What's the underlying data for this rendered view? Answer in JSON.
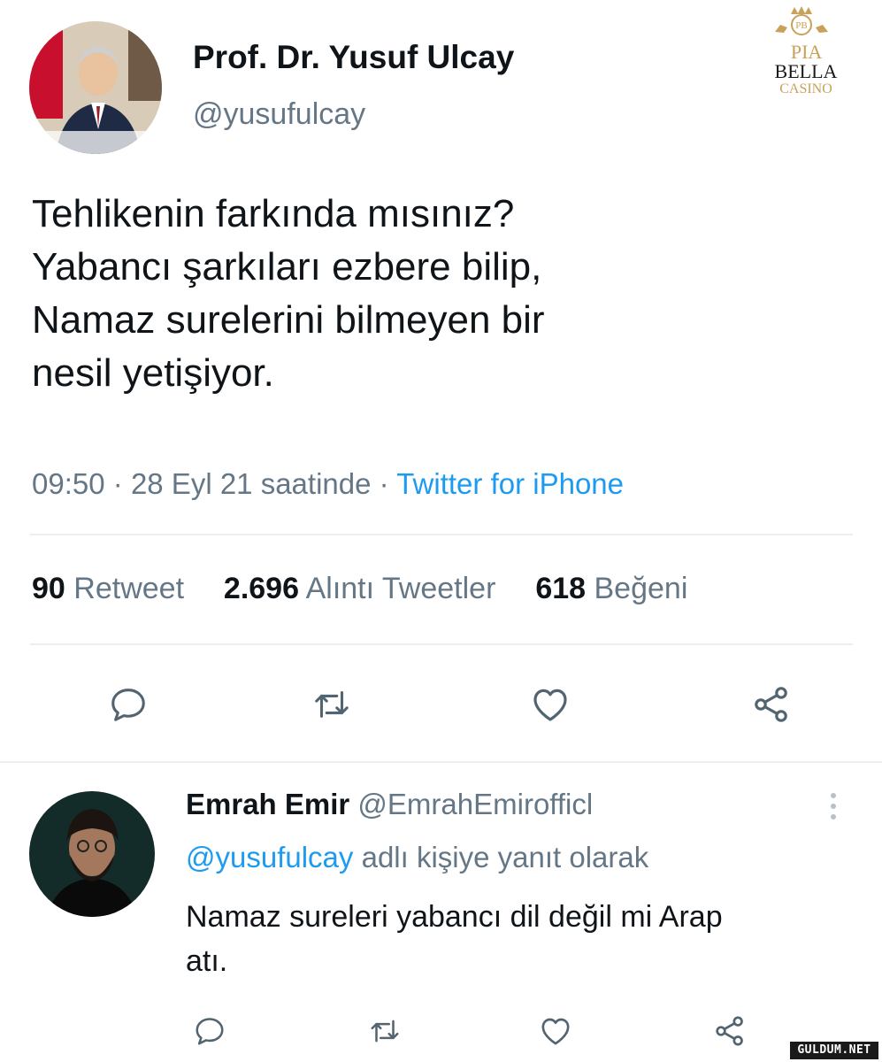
{
  "watermark": {
    "text_pia": "PIA",
    "text_bella": "BELLA",
    "text_casino": "CASINO",
    "monogram": "PB",
    "brand_color": "#c8a15a"
  },
  "tweet": {
    "display_name": "Prof. Dr. Yusuf Ulcay",
    "handle": "@yusufulcay",
    "text_lines": [
      "Tehlikenin farkında mısınız?",
      "Yabancı şarkıları ezbere bilip,",
      "Namaz surelerini bilmeyen bir",
      "nesil yetişiyor."
    ],
    "time": "09:50",
    "date": "28 Eyl 21 saatinde",
    "separator": "·",
    "source": "Twitter for iPhone",
    "stats": {
      "retweets_count": "90",
      "retweets_label": "Retweet",
      "quotes_count": "2.696",
      "quotes_label": "Alıntı Tweetler",
      "likes_count": "618",
      "likes_label": "Beğeni"
    }
  },
  "reply": {
    "display_name": "Emrah Emir",
    "handle": "@EmrahEmirofficl",
    "reply_to_handle": "@yusufulcay",
    "reply_to_text": "adlı kişiye yanıt olarak",
    "text_lines": [
      "Namaz sureleri yabancı dil değil mi Arap",
      "atı."
    ]
  },
  "footer_watermark": "GULDUM.NET",
  "colors": {
    "link": "#1d9bf0",
    "muted": "#657786",
    "icon": "#536471",
    "divider": "#eeeeee"
  },
  "icons": {
    "reply": "speech-bubble-icon",
    "retweet": "retweet-arrows-icon",
    "like": "heart-icon",
    "share": "share-nodes-icon",
    "more": "vertical-dots-icon"
  }
}
